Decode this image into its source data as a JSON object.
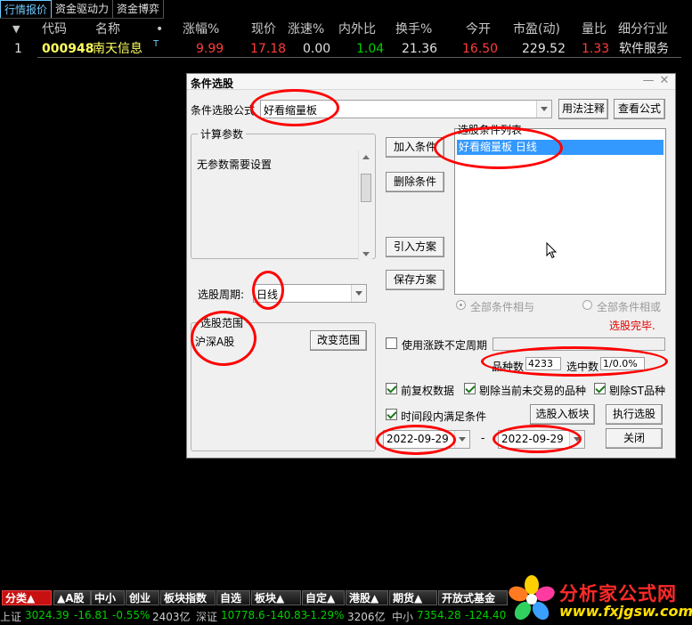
{
  "top_tabs": [
    "行情报价",
    "资金驱动力",
    "资金博弈"
  ],
  "quote_header": {
    "sort_arrow": "▼",
    "code": "代码",
    "name": "名称",
    "dot": "•",
    "change_pct": "涨幅%",
    "price": "现价",
    "speed": "涨速%",
    "in_out": "内外比",
    "turnover": "换手%",
    "open": "今开",
    "pe": "市盈(动)",
    "vol_ratio": "量比",
    "industry": "细分行业"
  },
  "quote_row": {
    "index": "1",
    "code": "000948",
    "name": "南天信息",
    "flag": "T",
    "change_pct": "9.99",
    "price": "17.18",
    "speed": "0.00",
    "in_out": "1.04",
    "turnover": "21.36",
    "open": "16.50",
    "pe": "229.52",
    "vol_ratio": "1.33",
    "industry": "软件服务"
  },
  "dialog": {
    "title": "条件选股",
    "minimize": "—",
    "close": "✕",
    "formula_label": "条件选股公式",
    "formula_value": "好看缩量板",
    "usage_button": "用法注释",
    "view_formula_button": "查看公式",
    "calc_params_title": "计算参数",
    "calc_params_text": "无参数需要设置",
    "period_label": "选股周期:",
    "period_value": "日线",
    "range_title": "选股范围",
    "range_value": "沪深A股",
    "change_range_button": "改变范围",
    "add_condition_button": "加入条件",
    "delete_condition_button": "删除条件",
    "import_plan_button": "引入方案",
    "save_plan_button": "保存方案",
    "condition_list_title": "选股条件列表",
    "condition_item": "好看缩量板  日线",
    "radio_and": "全部条件相与",
    "radio_or": "全部条件相或",
    "status": "选股完毕.",
    "use_uncertain_period": "使用涨跌不定周期",
    "count_label": "品种数",
    "count_value": "4233",
    "selected_label": "选中数",
    "selected_value": "1/0.0%",
    "pre_adjust": "前复权数据",
    "exclude_no_trade": "剔除当前未交易的品种",
    "exclude_st": "剔除ST品种",
    "time_range_check": "时间段内满足条件",
    "to_block_button": "选股入板块",
    "execute_button": "执行选股",
    "date_from": "2022-09-29",
    "date_sep": "-",
    "date_to": "2022-09-29",
    "close_button": "关闭"
  },
  "bottom_tabs": [
    "分类▲",
    "A股",
    "中小",
    "创业",
    "板块指数",
    "自选",
    "板块",
    "自定▲",
    "港股▲",
    "期货▲",
    "开放式基金"
  ],
  "index_bar": {
    "sh_name": "上证",
    "sh_value": "3024.39",
    "sh_change": "-16.81",
    "sh_pct": "-0.55%",
    "sh_vol": "2403亿",
    "sz_name": "深证",
    "sz_value": "10778.6",
    "sz_change": "-140.83",
    "sz_pct": "-1.29%",
    "sz_vol": "3206亿",
    "zx_name": "中小",
    "zx_value": "7354.28",
    "zx_change": "-124.40"
  },
  "logo": {
    "text": "分析家公式网",
    "url": "www.fxjgsw.com"
  },
  "colors": {
    "up": "#ff3c3c",
    "down": "#00d000",
    "code_yellow": "#ffff60",
    "annotation_red": "#ff0000",
    "selection_blue": "#3399ff"
  }
}
